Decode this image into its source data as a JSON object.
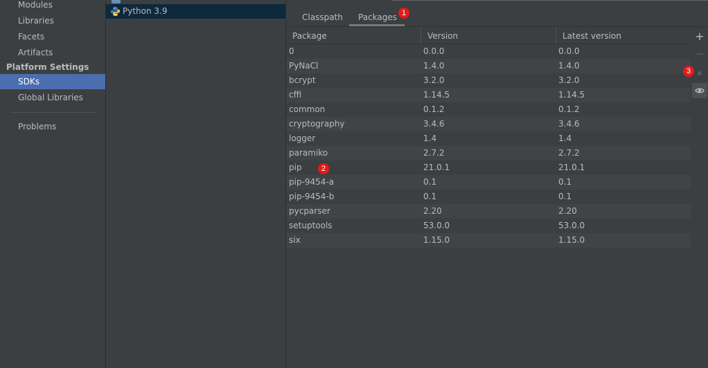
{
  "sidebar": {
    "items": [
      {
        "label": "Modules"
      },
      {
        "label": "Libraries"
      },
      {
        "label": "Facets"
      },
      {
        "label": "Artifacts"
      }
    ],
    "section_header": "Platform Settings",
    "platform_items": [
      {
        "label": "SDKs",
        "selected": true
      },
      {
        "label": "Global Libraries"
      }
    ],
    "problems": "Problems"
  },
  "sdk_list": {
    "items": [
      {
        "label": "Python 3.9",
        "selected": true
      }
    ]
  },
  "tabs": {
    "classpath": "Classpath",
    "packages": "Packages",
    "active": "packages"
  },
  "table": {
    "columns": [
      "Package",
      "Version",
      "Latest version"
    ],
    "rows": [
      [
        "0",
        "0.0.0",
        "0.0.0"
      ],
      [
        "PyNaCl",
        "1.4.0",
        "1.4.0"
      ],
      [
        "bcrypt",
        "3.2.0",
        "3.2.0"
      ],
      [
        "cffi",
        "1.14.5",
        "1.14.5"
      ],
      [
        "common",
        "0.1.2",
        "0.1.2"
      ],
      [
        "cryptography",
        "3.4.6",
        "3.4.6"
      ],
      [
        "logger",
        "1.4",
        "1.4"
      ],
      [
        "paramiko",
        "2.7.2",
        "2.7.2"
      ],
      [
        "pip",
        "21.0.1",
        "21.0.1"
      ],
      [
        "pip-9454-a",
        "0.1",
        "0.1"
      ],
      [
        "pip-9454-b",
        "0.1",
        "0.1"
      ],
      [
        "pycparser",
        "2.20",
        "2.20"
      ],
      [
        "setuptools",
        "53.0.0",
        "53.0.0"
      ],
      [
        "six",
        "1.15.0",
        "1.15.0"
      ]
    ]
  },
  "toolbar": {
    "add_glyph": "+",
    "remove_glyph": "−",
    "upgrade_glyph": "▲",
    "icons": [
      "plus-icon",
      "minus-icon",
      "upgrade-arrow-icon",
      "eye-icon"
    ]
  },
  "markers": {
    "m1": "1",
    "m2": "2",
    "m3": "3"
  },
  "colors": {
    "selection": "#4b6eaf",
    "sdk_selection": "#0d293e",
    "marker": "#e31b1b"
  }
}
